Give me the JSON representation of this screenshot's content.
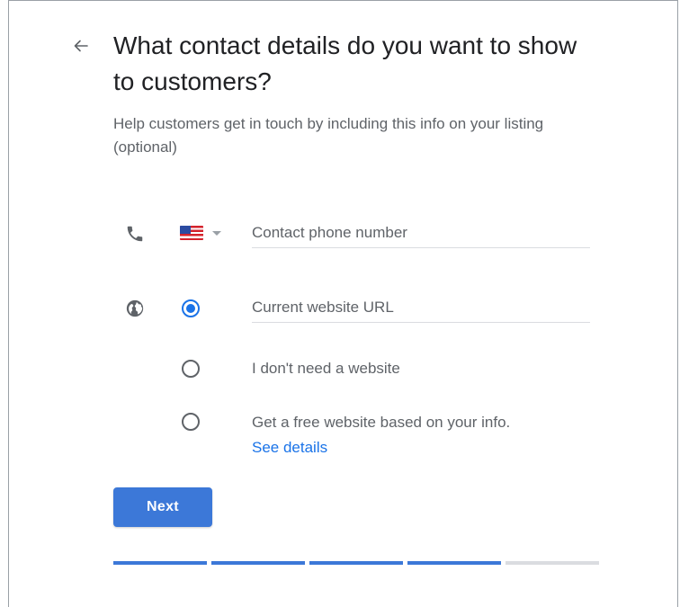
{
  "header": {
    "back_icon": "arrow-back-icon",
    "title": "What contact details do you want to show to customers?",
    "subtitle": "Help customers get in touch by including this info on your listing (optional)"
  },
  "phone": {
    "icon": "phone-icon",
    "country_flag": "us-flag-icon",
    "placeholder": "Contact phone number",
    "value": ""
  },
  "website": {
    "icon": "globe-icon",
    "options": [
      {
        "type": "input",
        "placeholder": "Current website URL",
        "selected": true
      },
      {
        "type": "label",
        "label": "I don't need a website",
        "selected": false
      },
      {
        "type": "label",
        "label": "Get a free website based on your info.",
        "link": "See details",
        "selected": false
      }
    ]
  },
  "actions": {
    "next_label": "Next"
  },
  "progress": {
    "total_steps": 5,
    "completed_steps": 4
  },
  "colors": {
    "accent": "#1a73e8",
    "button": "#3c78d8",
    "text": "#202124",
    "muted": "#5f6368",
    "divider": "#dadce0"
  }
}
